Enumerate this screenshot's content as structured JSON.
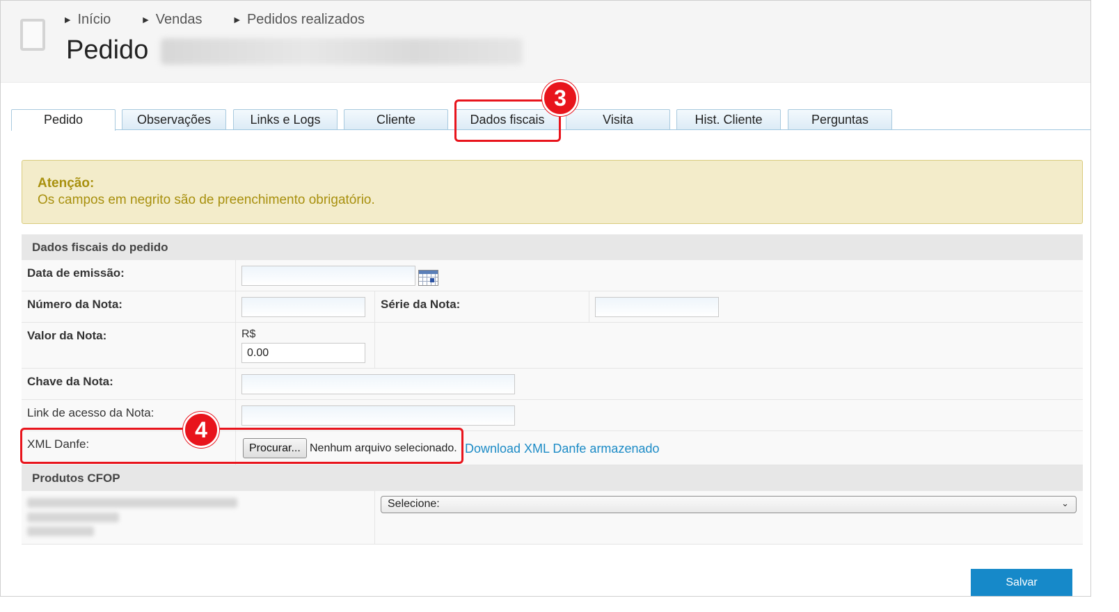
{
  "breadcrumb": [
    "Início",
    "Vendas",
    "Pedidos realizados"
  ],
  "header": {
    "title": "Pedido"
  },
  "tabs": [
    "Pedido",
    "Observações",
    "Links e Logs",
    "Cliente",
    "Dados fiscais",
    "Visita",
    "Hist. Cliente",
    "Perguntas"
  ],
  "active_tab": "Pedido",
  "annotations": {
    "step3": "3",
    "step4": "4",
    "color": "#e8141c"
  },
  "alert": {
    "title": "Atenção:",
    "message": "Os campos em negrito são de preenchimento obrigatório."
  },
  "form": {
    "section_title": "Dados fiscais do pedido",
    "data_emissao_label": "Data de emissão:",
    "numero_nota_label": "Número da Nota:",
    "serie_nota_label": "Série da Nota:",
    "valor_nota_label": "Valor da Nota:",
    "currency": "R$",
    "valor_nota_value": "0.00",
    "chave_nota_label": "Chave da Nota:",
    "link_acesso_label": "Link de acesso da Nota:",
    "xml_danfe_label": "XML Danfe:",
    "file_button": "Procurar...",
    "file_status": "Nenhum arquivo selecionado.",
    "download_link": "Download XML Danfe armazenado"
  },
  "produtos": {
    "section_title": "Produtos CFOP",
    "select_value": "Selecione:"
  },
  "save_button": "Salvar",
  "colors": {
    "accent": "#1689c9",
    "alert_bg": "#f3ecca",
    "alert_text": "#a8900e",
    "highlight": "#e8141c"
  }
}
